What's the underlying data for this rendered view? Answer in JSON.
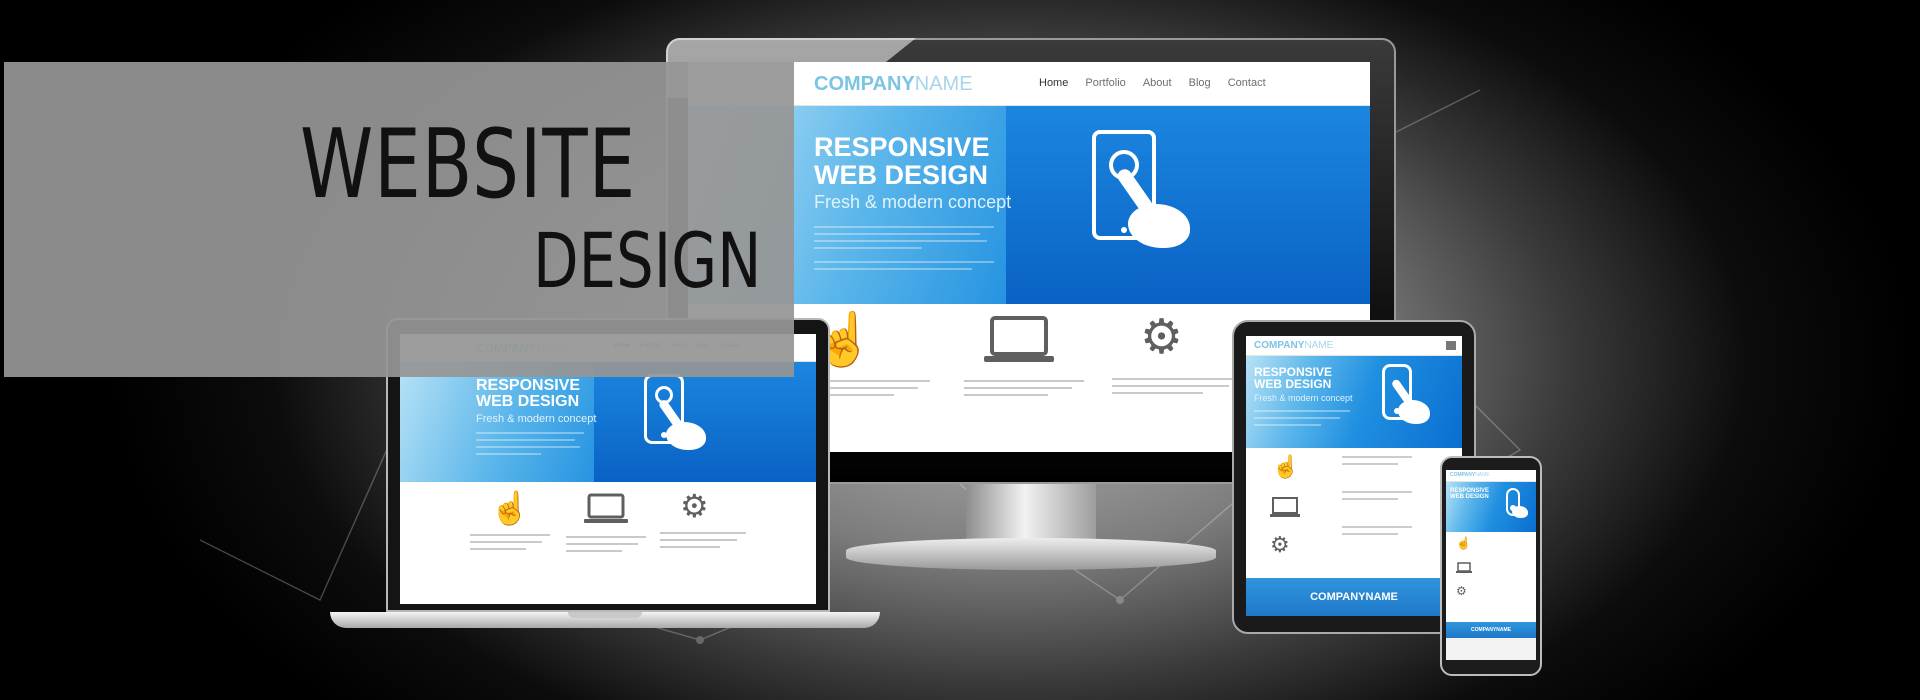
{
  "headline": {
    "line1": "WEBSITE",
    "line2": "DESIGN"
  },
  "site": {
    "logo_bold": "COMPANY",
    "logo_name": "NAME",
    "nav": [
      "Home",
      "Portfolio",
      "About",
      "Blog",
      "Contact"
    ],
    "hero_title_1": "RESPONSIVE",
    "hero_title_2": "WEB DESIGN",
    "hero_subtitle": "Fresh & modern concept",
    "footer_brand": "COMPANYNAME"
  },
  "icons": {
    "touch": "pointer-hand-icon",
    "laptop": "laptop-icon",
    "settings": "gears-icon",
    "phone": "smartphone-touch-icon"
  },
  "colors": {
    "accent_blue": "#1f8fe0",
    "logo_blue": "#2aa3d9",
    "banner_gray": "#969696"
  }
}
